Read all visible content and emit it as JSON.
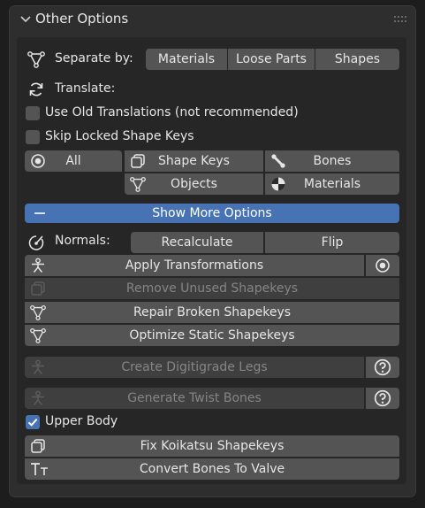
{
  "panel": {
    "title": "Other Options"
  },
  "separate": {
    "label": "Separate by:",
    "buttons": [
      "Materials",
      "Loose Parts",
      "Shapes"
    ]
  },
  "translate": {
    "label": "Translate:",
    "use_old_translations": "Use Old Translations (not recommended)",
    "skip_locked_shape_keys": "Skip Locked Shape Keys",
    "all": "All",
    "shape_keys": "Shape Keys",
    "bones": "Bones",
    "objects": "Objects",
    "materials": "Materials"
  },
  "show_more": {
    "icon": "minus-icon",
    "label": "Show More Options"
  },
  "normals": {
    "label": "Normals:",
    "recalculate": "Recalculate",
    "flip": "Flip"
  },
  "actions": {
    "apply_transformations": "Apply Transformations",
    "remove_unused_shapekeys": "Remove Unused Shapekeys",
    "repair_broken_shapekeys": "Repair Broken Shapekeys",
    "optimize_static_shapekeys": "Optimize Static Shapekeys",
    "create_digitigrade_legs": "Create Digitigrade Legs",
    "generate_twist_bones": "Generate Twist Bones",
    "upper_body": "Upper Body",
    "fix_koikatsu_shapekeys": "Fix Koikatsu Shapekeys",
    "convert_bones_to_valve": "Convert Bones To Valve"
  },
  "state": {
    "use_old_translations_checked": false,
    "skip_locked_checked": false,
    "upper_body_checked": true
  },
  "colors": {
    "accent": "#4772b3",
    "button": "#545454",
    "button_disabled": "#3f3f3f",
    "panel": "#2e2e2e",
    "background": "#1d1d1d"
  }
}
